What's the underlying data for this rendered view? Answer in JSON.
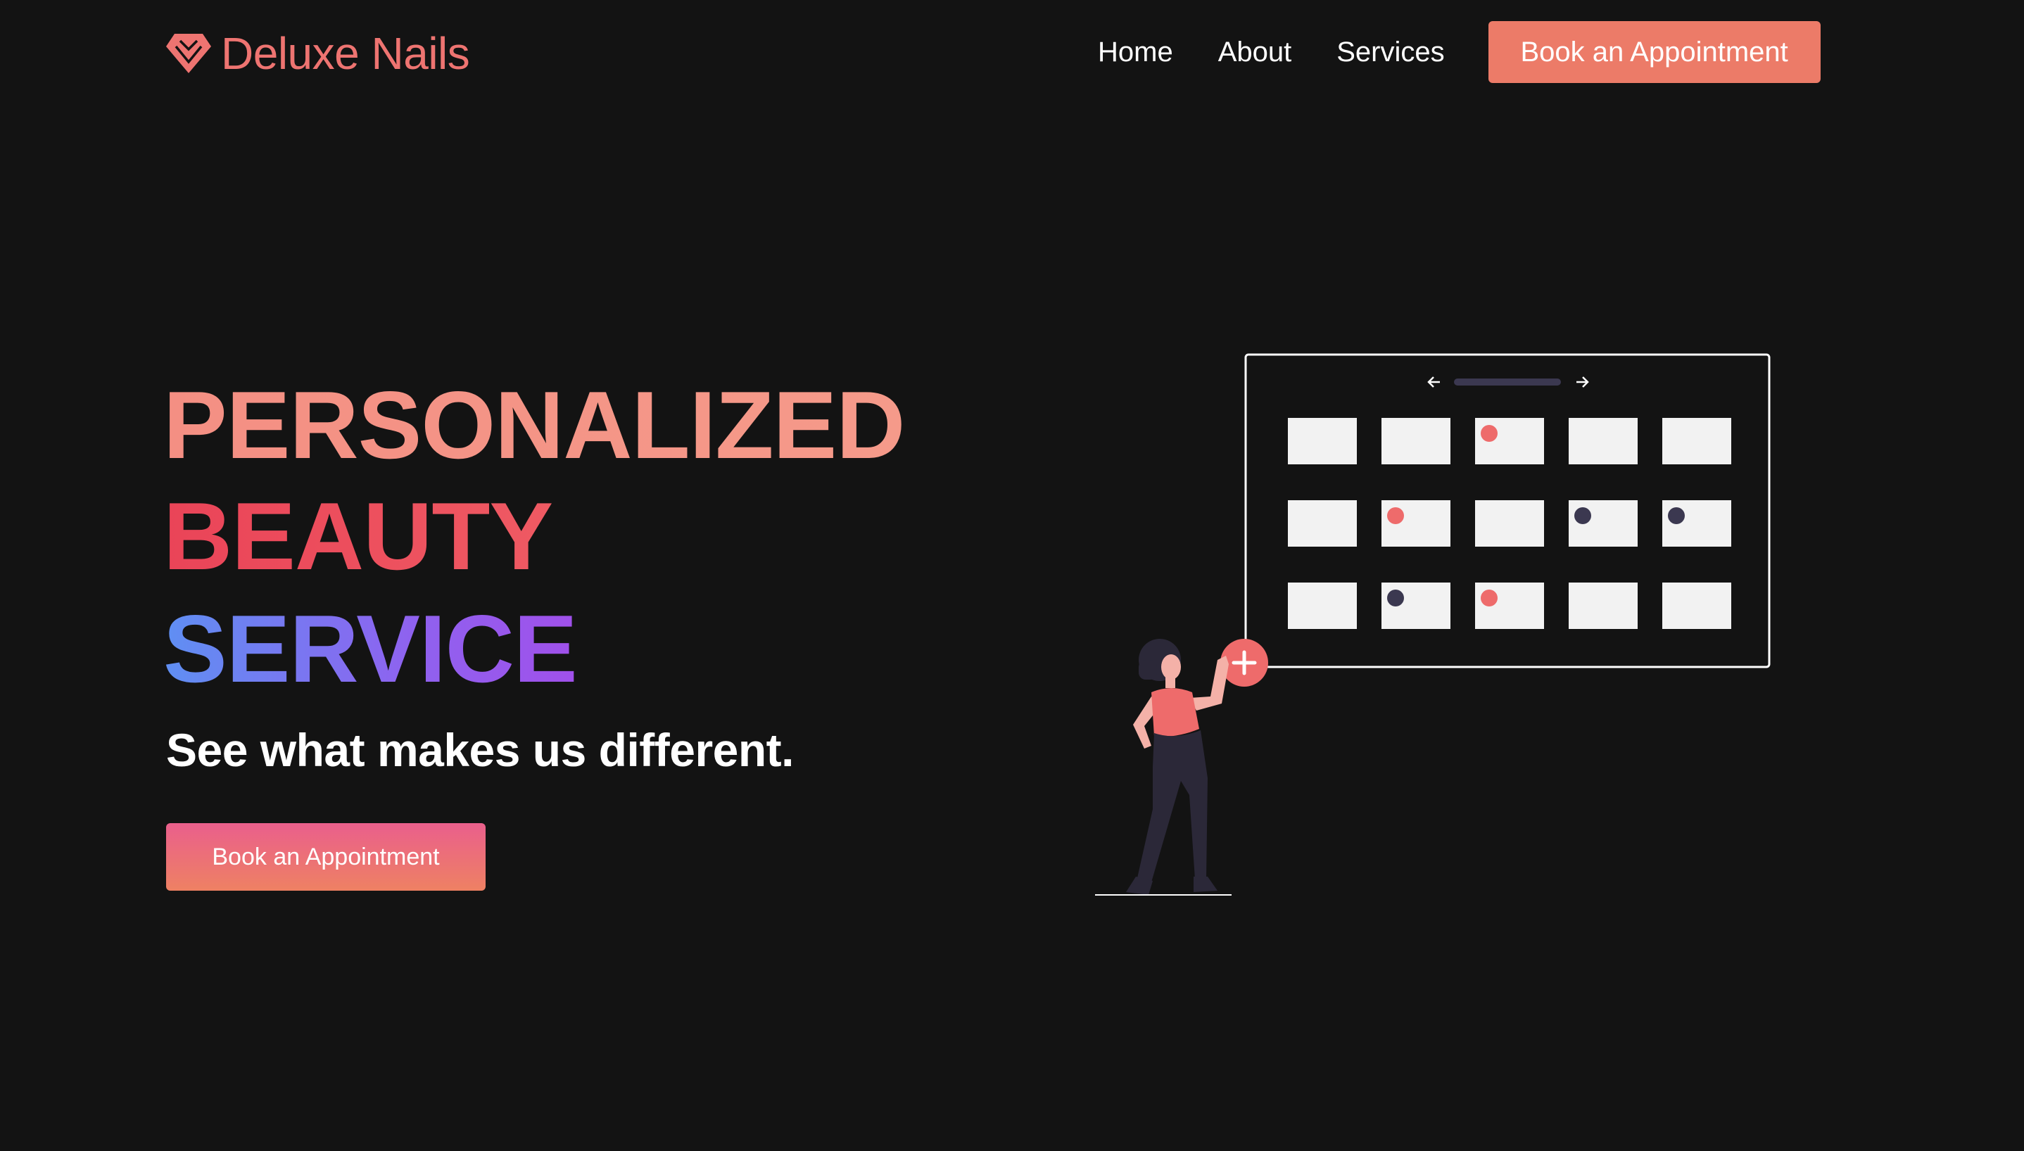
{
  "brand": {
    "name": "Deluxe Nails",
    "icon": "diamond-icon",
    "color": "#ee7471"
  },
  "nav": {
    "links": [
      "Home",
      "About",
      "Services"
    ],
    "cta_label": "Book an Appointment",
    "cta_color": "#ec7b68"
  },
  "hero": {
    "line1": "PERSONALIZED",
    "line2": "BEAUTY",
    "line3": "SERVICE",
    "subtitle": "See what makes us different.",
    "cta_label": "Book an Appointment"
  },
  "illustration": {
    "icon": "calendar-booking-illustration",
    "grid": {
      "rows": 3,
      "cols": 5,
      "marked": [
        {
          "row": 0,
          "col": 2,
          "color": "#ee6b6b"
        },
        {
          "row": 1,
          "col": 1,
          "color": "#ee6b6b"
        },
        {
          "row": 1,
          "col": 3,
          "color": "#3b3850"
        },
        {
          "row": 1,
          "col": 4,
          "color": "#3b3850"
        },
        {
          "row": 2,
          "col": 1,
          "color": "#3b3850"
        },
        {
          "row": 2,
          "col": 2,
          "color": "#ee6b6b"
        }
      ]
    },
    "colors": {
      "accent": "#ee6b6b",
      "dark": "#3b3850",
      "cell": "#f2f2f2",
      "outline": "#ffffff"
    }
  },
  "colors": {
    "background": "#131313"
  }
}
